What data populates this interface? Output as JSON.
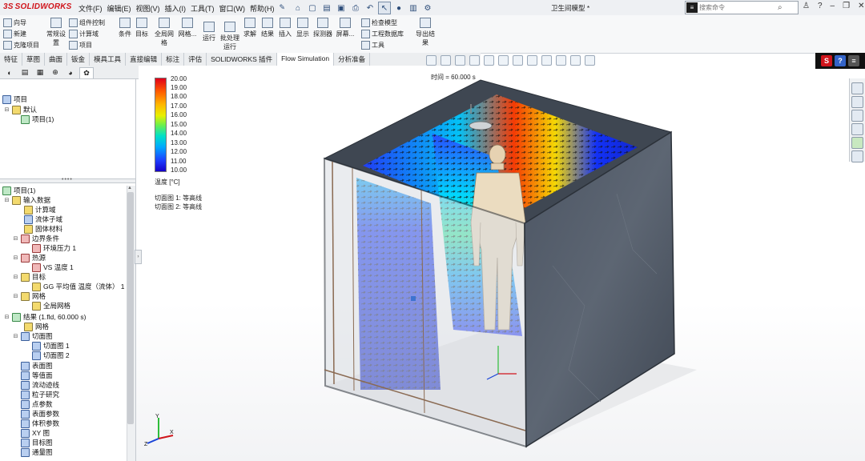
{
  "app": {
    "logo_text": "SOLIDWORKS",
    "brand_color": "#d0151c"
  },
  "menu": [
    "文件(F)",
    "编辑(E)",
    "视图(V)",
    "插入(I)",
    "工具(T)",
    "窗口(W)",
    "帮助(H)"
  ],
  "document_title": "卫生间模型 *",
  "search": {
    "placeholder": "搜索命令"
  },
  "ribbon": {
    "col1": [
      "向导",
      "新建",
      "克隆项目"
    ],
    "col2a": "常规设置",
    "col3": [
      "组件控制",
      "计算域",
      "项目"
    ],
    "group_conditions": "条件",
    "group_goals": "目标",
    "global_mesh": "全局网格",
    "mesh": "网格...",
    "run": "运行",
    "batch_run": "批处理运行",
    "solve": "求解",
    "results": "结果",
    "insert": "插入",
    "display": "显示",
    "probe": "探测器",
    "screen": "屏幕...",
    "check_model": "检查模型",
    "engineering_db": "工程数据库",
    "tools": "工具",
    "export_results": "导出结果"
  },
  "tabs": [
    "特征",
    "草图",
    "曲面",
    "钣金",
    "模具工具",
    "直接编辑",
    "标注",
    "评估",
    "SOLIDWORKS 插件",
    "Flow Simulation",
    "分析准备"
  ],
  "active_tab": "Flow Simulation",
  "top_tree": {
    "root": "项目",
    "config": "默认",
    "project": "项目(1)"
  },
  "tree": {
    "project": "项目(1)",
    "input_data": "输入数据",
    "domain": "计算域",
    "fluid_subdomain": "流体子域",
    "solid_material": "固体材料",
    "boundary_conditions": "边界条件",
    "env_pressure": "环境压力 1",
    "heat_source": "热源",
    "vs_temp": "VS 温度 1",
    "goals": "目标",
    "gg_goal": "GG 平均值 温度（流体） 1",
    "mesh": "网格",
    "global_mesh": "全局网格",
    "results": "结果 (1.fld, 60.000 s)",
    "results_mesh": "网格",
    "cut_plots": "切面图",
    "cut_plot_1": "切面图 1",
    "cut_plot_2": "切面图 2",
    "surface_plots": "表面图",
    "isosurfaces": "等值面",
    "flow_trajectories": "流动迹线",
    "particle_study": "粒子研究",
    "point_params": "点参数",
    "surface_params": "表面参数",
    "volume_params": "体积参数",
    "xy_plot": "XY 图",
    "goal_plot": "目标图",
    "report": "通量图"
  },
  "legend": {
    "values": [
      "20.00",
      "19.00",
      "18.00",
      "17.00",
      "16.00",
      "15.00",
      "14.00",
      "13.00",
      "12.00",
      "11.00",
      "10.00"
    ],
    "unit": "温度 [°C]",
    "cut_1": "切面图 1: 等高线",
    "cut_2": "切面图 2: 等高线"
  },
  "time_label": "时间 = 60.000 s",
  "triad_labels": {
    "x": "X",
    "y": "Y",
    "z": "Z"
  }
}
